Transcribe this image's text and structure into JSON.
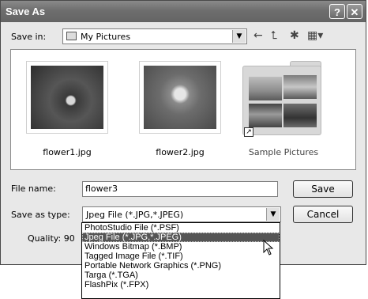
{
  "window": {
    "title": "Save As",
    "help_button": "?",
    "close_button": "✕"
  },
  "save_in": {
    "label": "Save in:",
    "value": "My Pictures"
  },
  "toolbar": {
    "back": "←",
    "up": "⮤",
    "new_folder": "✱",
    "views": "▦▾"
  },
  "files": [
    {
      "name": "flower1.jpg"
    },
    {
      "name": "flower2.jpg"
    },
    {
      "name": "Sample Pictures"
    }
  ],
  "file_name": {
    "label": "File name:",
    "value": "flower3"
  },
  "save_as_type": {
    "label": "Save as type:",
    "value": "Jpeg File (*.JPG,*.JPEG)",
    "options": [
      "PhotoStudio File (*.PSF)",
      "Jpeg File (*.JPG,*.JPEG)",
      "Windows Bitmap (*.BMP)",
      "Tagged Image File (*.TIF)",
      "Portable Network Graphics (*.PNG)",
      "Targa (*.TGA)",
      "FlashPix (*.FPX)"
    ],
    "selected_index": 1
  },
  "buttons": {
    "save": "Save",
    "cancel": "Cancel"
  },
  "quality": {
    "label": "Quality: 90"
  }
}
